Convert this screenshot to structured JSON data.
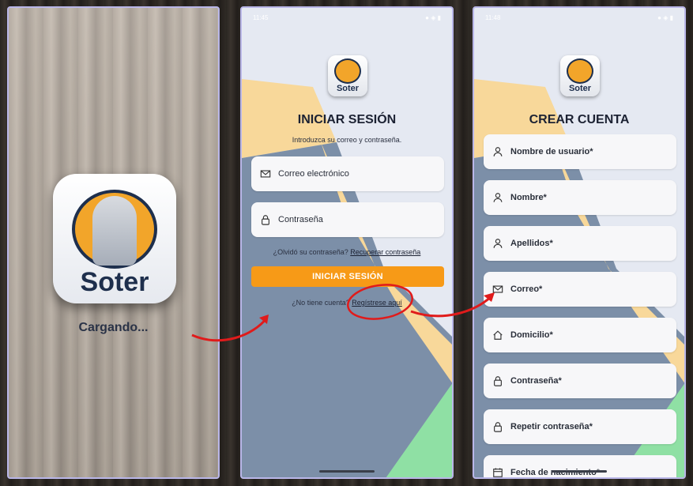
{
  "splash": {
    "logo_text": "Soter",
    "loading_text": "Cargando..."
  },
  "login": {
    "time": "11:45",
    "logo_text": "Soter",
    "title": "INICIAR SESIÓN",
    "subtitle": "Introduzca su correo y contraseña.",
    "email_placeholder": "Correo electrónico",
    "password_placeholder": "Contraseña",
    "forgot_text": "¿Olvidó su contraseña?",
    "recover_link": "Recuperar contraseña",
    "login_button": "INICIAR SESIÓN",
    "no_account_text": "¿No tiene cuenta?",
    "register_link": "Regístrese aquí"
  },
  "register": {
    "time": "11:48",
    "logo_text": "Soter",
    "title": "CREAR CUENTA",
    "fields": [
      {
        "label": "Nombre de usuario*",
        "icon": "user-icon"
      },
      {
        "label": "Nombre*",
        "icon": "user-icon"
      },
      {
        "label": "Apellidos*",
        "icon": "user-icon"
      },
      {
        "label": "Correo*",
        "icon": "mail-icon"
      },
      {
        "label": "Domicilio*",
        "icon": "home-icon"
      },
      {
        "label": "Contraseña*",
        "icon": "lock-icon"
      },
      {
        "label": "Repetir contraseña*",
        "icon": "lock-icon"
      },
      {
        "label": "Fecha de nacimiento*",
        "icon": "calendar-icon"
      }
    ]
  },
  "colors": {
    "accent": "#f79a17",
    "logo_orange": "#f2a52a",
    "navy": "#1e2f4d",
    "annotation_red": "#e01b1b"
  }
}
